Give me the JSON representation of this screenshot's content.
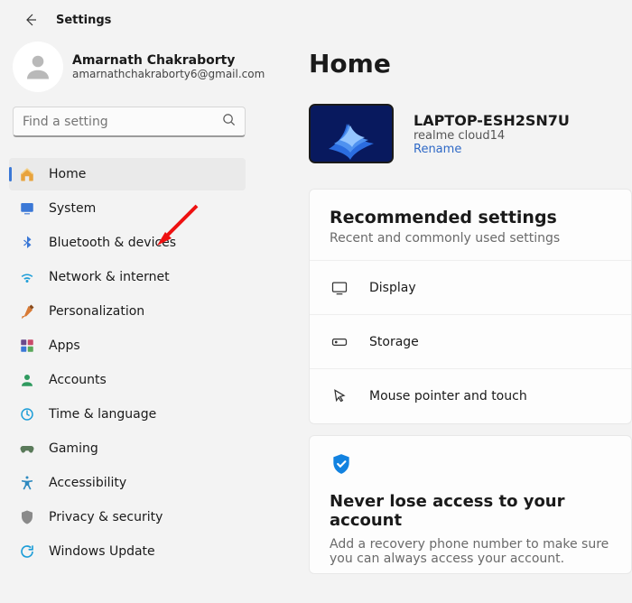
{
  "header": {
    "title": "Settings"
  },
  "account": {
    "name": "Amarnath Chakraborty",
    "email": "amarnathchakraborty6@gmail.com"
  },
  "search": {
    "placeholder": "Find a setting"
  },
  "nav": {
    "home": "Home",
    "system": "System",
    "bluetooth": "Bluetooth & devices",
    "network": "Network & internet",
    "personalization": "Personalization",
    "apps": "Apps",
    "accounts": "Accounts",
    "time": "Time & language",
    "gaming": "Gaming",
    "accessibility": "Accessibility",
    "privacy": "Privacy & security",
    "update": "Windows Update"
  },
  "main": {
    "heading": "Home",
    "device": {
      "name": "LAPTOP-ESH2SN7U",
      "model": "realme cloud14",
      "rename": "Rename"
    },
    "recommended": {
      "title": "Recommended settings",
      "subtitle": "Recent and commonly used settings",
      "display": "Display",
      "storage": "Storage",
      "mouse": "Mouse pointer and touch"
    },
    "backup": {
      "title": "Never lose access to your account",
      "body": "Add a recovery phone number to make sure you can always access your account."
    }
  }
}
